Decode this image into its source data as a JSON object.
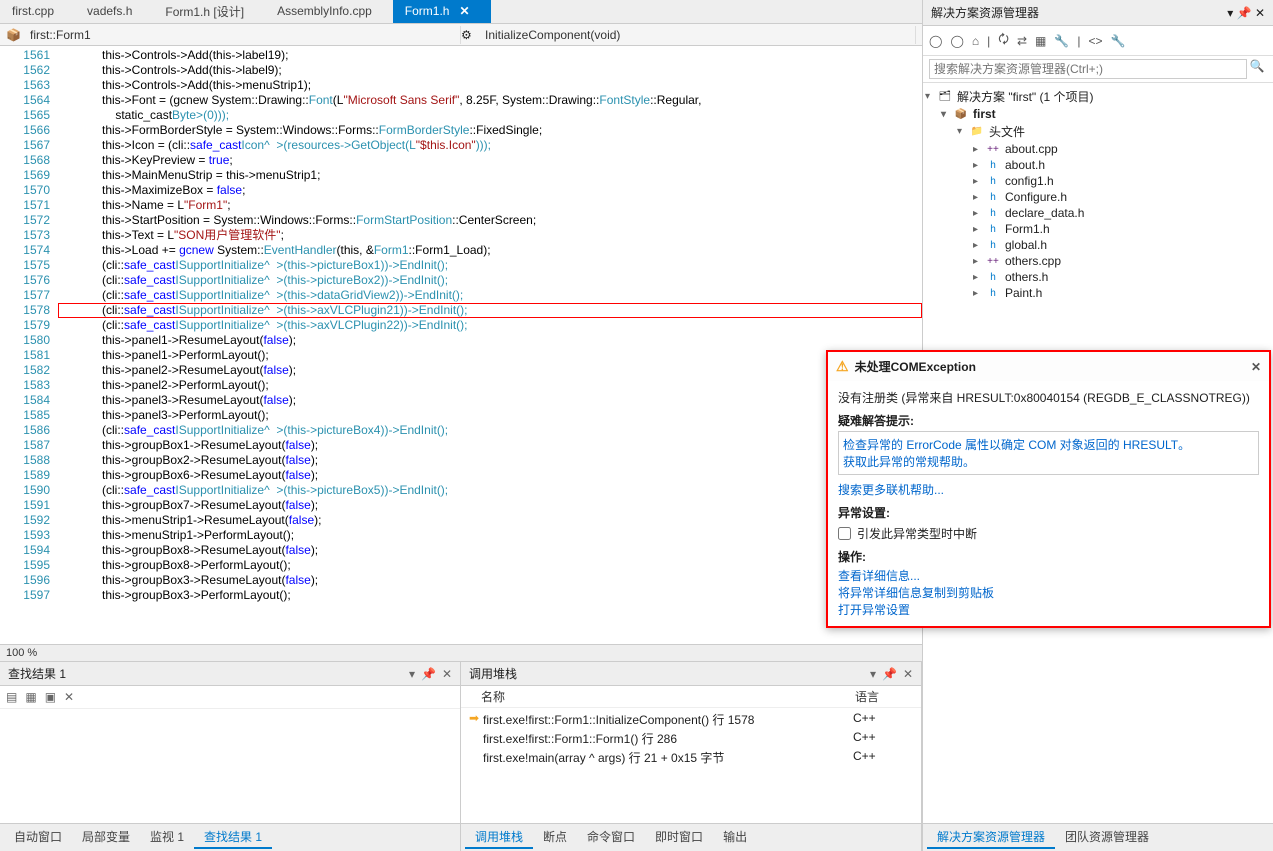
{
  "tabs": [
    {
      "label": "first.cpp"
    },
    {
      "label": "vadefs.h"
    },
    {
      "label": "Form1.h [设计]"
    },
    {
      "label": "AssemblyInfo.cpp"
    },
    {
      "label": "Form1.h",
      "active": true
    }
  ],
  "nav": {
    "scope": "first::Form1",
    "member": "InitializeComponent(void)"
  },
  "lines": [
    {
      "n": 1561,
      "t": "            this->Controls->Add(this->label19);"
    },
    {
      "n": 1562,
      "t": "            this->Controls->Add(this->label9);"
    },
    {
      "n": 1563,
      "t": "            this->Controls->Add(this->menuStrip1);"
    },
    {
      "n": 1564,
      "t": "            this->Font = (gcnew System::Drawing::<type>Font</type>(L<str>\"Microsoft Sans Serif\"</str>, 8.25F, System::Drawing::<type>FontStyle</type>::Regular,"
    },
    {
      "n": 1565,
      "t": "                static_cast<System::<type>Byte</type>>(0)));"
    },
    {
      "n": 1566,
      "t": "            this->FormBorderStyle = System::Windows::Forms::<type>FormBorderStyle</type>::FixedSingle;"
    },
    {
      "n": 1567,
      "t": "            this->Icon = (cli::<kw>safe_cast</kw><System::Drawing::<type>Icon</type>^  >(resources->GetObject(L<str>\"$this.Icon\"</str>)));"
    },
    {
      "n": 1568,
      "t": "            this->KeyPreview = <kw>true</kw>;"
    },
    {
      "n": 1569,
      "t": "            this->MainMenuStrip = this->menuStrip1;"
    },
    {
      "n": 1570,
      "t": "            this->MaximizeBox = <kw>false</kw>;"
    },
    {
      "n": 1571,
      "t": "            this->Name = L<str>\"Form1\"</str>;"
    },
    {
      "n": 1572,
      "t": "            this->StartPosition = System::Windows::Forms::<type>FormStartPosition</type>::CenterScreen;"
    },
    {
      "n": 1573,
      "t": "            this->Text = L<str>\"SON用户管理软件\"</str>;"
    },
    {
      "n": 1574,
      "t": "            this->Load += <kw>gcnew</kw> System::<type>EventHandler</type>(this, &<type>Form1</type>::Form1_Load);"
    },
    {
      "n": 1575,
      "t": "            (cli::<kw>safe_cast</kw><System::ComponentModel::<type>ISupportInitialize</type>^  >(this->pictureBox1))->EndInit();"
    },
    {
      "n": 1576,
      "t": "            (cli::<kw>safe_cast</kw><System::ComponentModel::<type>ISupportInitialize</type>^  >(this->pictureBox2))->EndInit();"
    },
    {
      "n": 1577,
      "t": "            (cli::<kw>safe_cast</kw><System::ComponentModel::<type>ISupportInitialize</type>^  >(this->dataGridView2))->EndInit();"
    },
    {
      "n": 1578,
      "t": "            (cli::<kw>safe_cast</kw><System::ComponentModel::<type>ISupportInitialize</type>^  >(this->axVLCPlugin21))->EndInit();",
      "hl": true
    },
    {
      "n": 1579,
      "t": "            (cli::<kw>safe_cast</kw><System::ComponentModel::<type>ISupportInitialize</type>^  >(this->axVLCPlugin22))->EndInit();"
    },
    {
      "n": 1580,
      "t": "            this->panel1->ResumeLayout(<kw>false</kw>);"
    },
    {
      "n": 1581,
      "t": "            this->panel1->PerformLayout();"
    },
    {
      "n": 1582,
      "t": "            this->panel2->ResumeLayout(<kw>false</kw>);"
    },
    {
      "n": 1583,
      "t": "            this->panel2->PerformLayout();"
    },
    {
      "n": 1584,
      "t": "            this->panel3->ResumeLayout(<kw>false</kw>);"
    },
    {
      "n": 1585,
      "t": "            this->panel3->PerformLayout();"
    },
    {
      "n": 1586,
      "t": "            (cli::<kw>safe_cast</kw><System::ComponentModel::<type>ISupportInitialize</type>^  >(this->pictureBox4))->EndInit();"
    },
    {
      "n": 1587,
      "t": "            this->groupBox1->ResumeLayout(<kw>false</kw>);"
    },
    {
      "n": 1588,
      "t": "            this->groupBox2->ResumeLayout(<kw>false</kw>);"
    },
    {
      "n": 1589,
      "t": "            this->groupBox6->ResumeLayout(<kw>false</kw>);"
    },
    {
      "n": 1590,
      "t": "            (cli::<kw>safe_cast</kw><System::ComponentModel::<type>ISupportInitialize</type>^  >(this->pictureBox5))->EndInit();"
    },
    {
      "n": 1591,
      "t": "            this->groupBox7->ResumeLayout(<kw>false</kw>);"
    },
    {
      "n": 1592,
      "t": "            this->menuStrip1->ResumeLayout(<kw>false</kw>);"
    },
    {
      "n": 1593,
      "t": "            this->menuStrip1->PerformLayout();"
    },
    {
      "n": 1594,
      "t": "            this->groupBox8->ResumeLayout(<kw>false</kw>);"
    },
    {
      "n": 1595,
      "t": "            this->groupBox8->PerformLayout();"
    },
    {
      "n": 1596,
      "t": "            this->groupBox3->ResumeLayout(<kw>false</kw>);"
    },
    {
      "n": 1597,
      "t": "            this->groupBox3->PerformLayout();"
    }
  ],
  "zoom": "100 %",
  "find": {
    "title": "查找结果 1",
    "tabs": [
      "自动窗口",
      "局部变量",
      "监视 1",
      "查找结果 1"
    ]
  },
  "stack": {
    "title": "调用堆栈",
    "colName": "名称",
    "colLang": "语言",
    "rows": [
      {
        "name": "first.exe!first::Form1::InitializeComponent() 行 1578",
        "lang": "C++",
        "cur": true
      },
      {
        "name": "first.exe!first::Form1::Form1() 行 286",
        "lang": "C++"
      },
      {
        "name": "first.exe!main(array<System::String^> ^ args) 行 21 + 0x15 字节",
        "lang": "C++"
      }
    ],
    "tabs": [
      "调用堆栈",
      "断点",
      "命令窗口",
      "即时窗口",
      "输出"
    ]
  },
  "solution": {
    "title": "解决方案资源管理器",
    "search": "搜索解决方案资源管理器(Ctrl+;)",
    "root": "解决方案 \"first\" (1 个项目)",
    "proj": "first",
    "headerFolder": "头文件",
    "files": [
      "about.cpp",
      "about.h",
      "config1.h",
      "Configure.h",
      "declare_data.h",
      "Form1.h",
      "global.h",
      "others.cpp",
      "others.h",
      "Paint.h"
    ],
    "bottomTabs": [
      "解决方案资源管理器",
      "团队资源管理器"
    ]
  },
  "exception": {
    "title": "未处理COMException",
    "msg": "没有注册类 (异常来自 HRESULT:0x80040154 (REGDB_E_CLASSNOTREG))",
    "hintsTitle": "疑难解答提示:",
    "hint1": "检查异常的 ErrorCode 属性以确定 COM 对象返回的 HRESULT。",
    "hint2": "获取此异常的常规帮助。",
    "moreHelp": "搜索更多联机帮助...",
    "settingsTitle": "异常设置:",
    "chkLabel": "引发此异常类型时中断",
    "opsTitle": "操作:",
    "op1": "查看详细信息...",
    "op2": "将异常详细信息复制到剪贴板",
    "op3": "打开异常设置"
  }
}
